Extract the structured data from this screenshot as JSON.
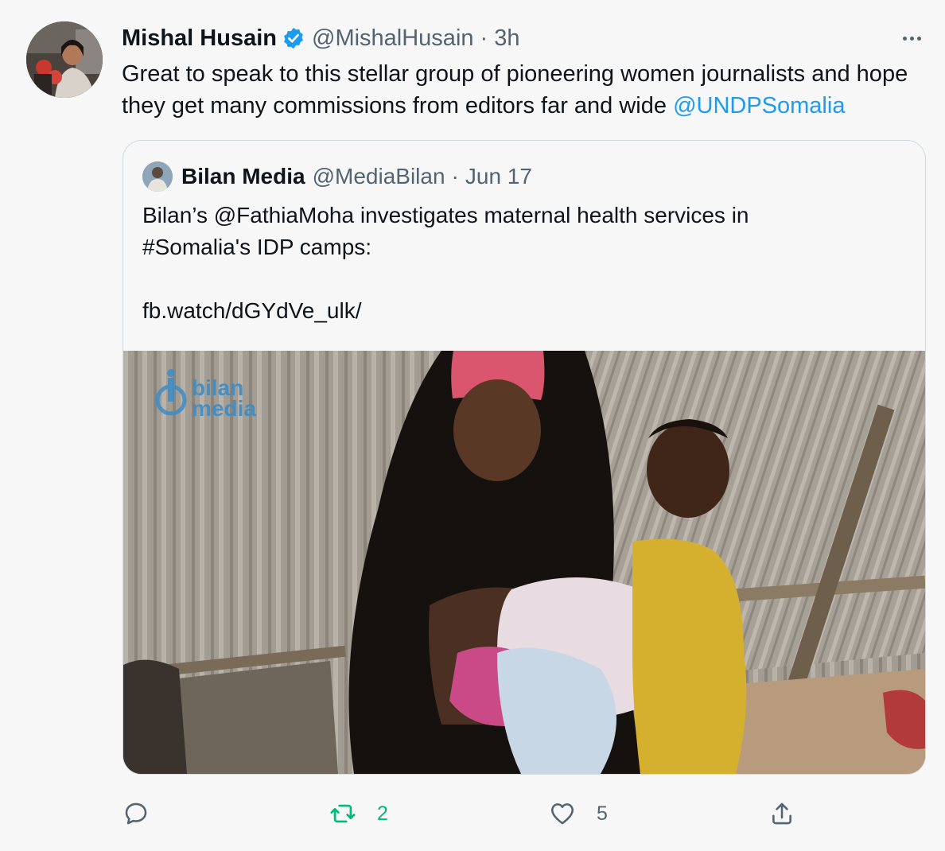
{
  "author": {
    "name": "Mishal Husain",
    "handle": "@MishalHusain",
    "time": "3h",
    "avatar_icon": "profile-photo"
  },
  "tweet": {
    "text_before": "Great to speak to this stellar group of pioneering women journalists and hope they get many commissions from editors far and wide ",
    "mention": "@UNDPSomalia"
  },
  "quote": {
    "name": "Bilan Media",
    "handle": "@MediaBilan",
    "time": "Jun 17",
    "line1": "Bilan’s @FathiaMoha investigates maternal health services in",
    "line2": "#Somalia's IDP camps:",
    "link": "fb.watch/dGYdVe_ulk/",
    "media_logo_line1": "bilan",
    "media_logo_line2": "media"
  },
  "actions": {
    "reply_count": "",
    "retweet_count": "2",
    "like_count": "5"
  },
  "colors": {
    "accent": "#1d9bf0",
    "retweet_green": "#00ba7c",
    "muted": "#536471",
    "background": "#f7f7f7"
  }
}
